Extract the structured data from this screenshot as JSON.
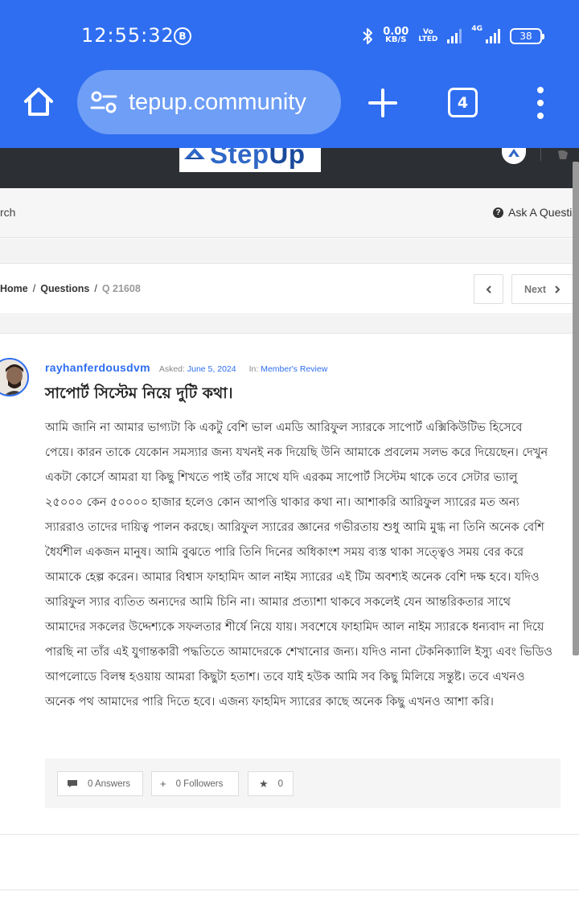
{
  "status_bar": {
    "time": "12:55:32",
    "b_badge": "B",
    "speed_value": "0.00",
    "speed_unit": "KB/S",
    "volte_top": "Vo",
    "volte_bottom": "LTED",
    "network": "4G",
    "battery": "38"
  },
  "browser": {
    "url": "tepup.community",
    "tab_count": "4"
  },
  "site": {
    "logo_text_a": "Step",
    "logo_text_b": "Up",
    "search_label": "rch",
    "ask_label": "Ask A Questio"
  },
  "breadcrumb": {
    "home": "Home",
    "questions": "Questions",
    "current": "Q 21608",
    "separator": "/",
    "next_label": "Next"
  },
  "question": {
    "author": "rayhanferdousdvm",
    "asked_label": "Asked:",
    "asked_date": "June 5, 2024",
    "in_label": "In:",
    "category": "Member's Review",
    "title": "সাপোর্ট সিস্টেম নিয়ে দুটি কথা।",
    "body": "আমি জানি না আমার ভাগ্যটা কি একটু বেশি ভাল এমডি আরিফুল স্যারকে সাপোর্ট এক্সিকিউটিভ হিসেবে পেয়ে। কারন তাকে যেকোন সমস্যার জন্য যখনই নক দিয়েছি উনি আমাকে প্রবলেম সলভ করে দিয়েছেন। দেখুন একটা কোর্সে আমরা যা কিছু শিখতে পাই তাঁর সাথে যদি এরকম সাপোর্ট সিস্টেম থাকে তবে সেটার ভ্যালু ২৫০০০ কেন ৫০০০০ হাজার হলেও কোন আপত্তি থাকার কথা না। আশাকরি আরিফুল স্যারের মত অন্য স্যাররাও তাদের দায়িত্ব পালন করছে। আরিফুল স্যারের জ্ঞানের গভীরতায় শুধু আমি মুগ্ধ না তিনি অনেক বেশি ধৈর্যশীল একজন মানুষ। আমি বুঝতে পারি তিনি দিনের অধিকাংশ সময় ব্যস্ত থাকা সত্ত্বেও সময় বের করে আমাকে হেল্প করেন। আমার বিশ্বাস ফাহামিদ আল নাইম স্যারের এই টিম অবশ্যই অনেক বেশি দক্ষ হবে। যদিও আরিফুল স্যার ব্যতিত অন্যদের আমি চিনি না। আমার প্রত্যাশা থাকবে সকলেই যেন আন্তরিকতার সাথে আমাদের সকলের উদ্দেশ্যকে সফলতার শীর্ষে নিয়ে যায়। সবশেষে ফাহামিদ আল নাইম স্যারকে ধন্যবাদ না দিয়ে পারছি না তাঁর এই যুগান্তকারী পদ্ধতিতে আমাদেরকে শেখানোর জন্য। যদিও নানা টেকনিক্যালি ইস্যু এবং ভিডিও আপলোডে বিলম্ব হওয়ায় আমরা কিছুটা হতাশ। তবে যাই হউক আমি সব কিছু মিলিয়ে সন্তুষ্ট। তবে এখনও অনেক পথ আমাদের পারি দিতে হবে। এজন্য ফাহমিদ স্যারের কাছে অনেক কিছু এখনও আশা করি।",
    "answers": "0 Answers",
    "followers": "0 Followers",
    "favorites": "0"
  },
  "colors": {
    "chrome_blue": "#2f6ef0",
    "url_pill": "#6e9ef6",
    "header_dark": "#2c2f34",
    "link_blue": "#2f6ef0"
  },
  "icons": {
    "home": "home-icon",
    "site_info": "tune-icon",
    "new_tab": "plus-icon",
    "menu": "kebab-menu-icon",
    "question": "question-circle-icon",
    "prev": "chevron-left-icon",
    "next": "chevron-right-icon",
    "answers": "comment-icon",
    "follow": "plus-icon",
    "favorite": "star-icon"
  }
}
